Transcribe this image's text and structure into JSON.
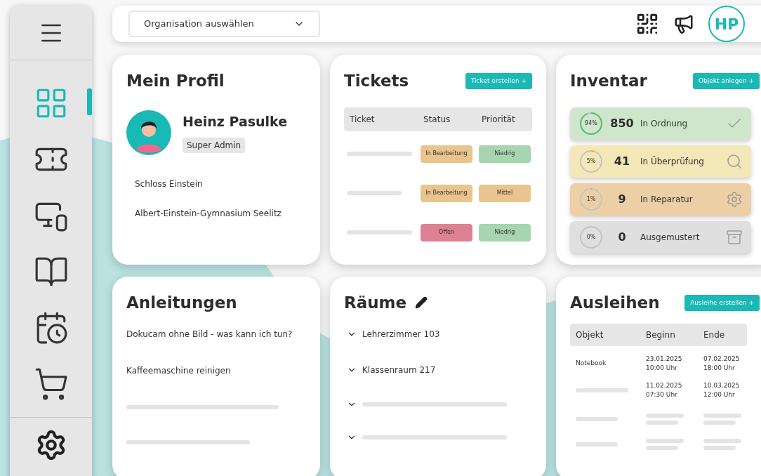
{
  "nav": {
    "items": [
      {
        "kind": "dashboard",
        "selected": true
      },
      {
        "kind": "tickets",
        "selected": false
      },
      {
        "kind": "devices",
        "selected": false
      },
      {
        "kind": "guides",
        "selected": false
      },
      {
        "kind": "calendar",
        "selected": false
      },
      {
        "kind": "shop",
        "selected": false
      }
    ]
  },
  "topbar": {
    "organisation_select": {
      "placeholder": "Organisation auswählen"
    },
    "avatar": "HP"
  },
  "profile": {
    "title": "Mein Profil",
    "name": "Heinz Pasulke",
    "role": "Super Admin",
    "organisations": [
      "Schloss Einstein",
      "Albert-Einstein-Gymnasium Seelitz"
    ]
  },
  "tickets": {
    "title": "Tickets",
    "button": "Ticket erstellen +",
    "columns": [
      "Ticket",
      "Status",
      "Priorität"
    ],
    "rows": [
      {
        "status": {
          "text": "In Bearbeitung",
          "color": "#eac48d"
        },
        "priority": {
          "text": "Niedrig",
          "color": "#a6d5b0"
        }
      },
      {
        "status": {
          "text": "In Bearbeitung",
          "color": "#eac48d"
        },
        "priority": {
          "text": "Mittel",
          "color": "#eac48d"
        }
      },
      {
        "status": {
          "text": "Offen",
          "color": "#de8193"
        },
        "priority": {
          "text": "Niedrig",
          "color": "#a6d5b0"
        }
      }
    ]
  },
  "inventory": {
    "title": "Inventar",
    "button": "Objekt anlegen +",
    "rows": [
      {
        "kind": "ok",
        "percent": "94%",
        "level": 0.94,
        "count": "850",
        "label": "In Ordnung",
        "color": "#d0e6cc"
      },
      {
        "kind": "review",
        "percent": "5%",
        "level": 0.05,
        "count": "41",
        "label": "In Überprüfung",
        "color": "#f2e8b8"
      },
      {
        "kind": "repair",
        "percent": "1%",
        "level": 0.01,
        "count": "9",
        "label": "In Reparatur",
        "color": "#edcfa6"
      },
      {
        "kind": "retired",
        "percent": "0%",
        "level": 0,
        "count": "0",
        "label": "Ausgemustert",
        "color": "#dfdfdf"
      }
    ]
  },
  "guides": {
    "title": "Anleitungen",
    "items": [
      "Dokucam ohne Bild - was kann ich tun?",
      "Kaffeemaschine reinigen"
    ]
  },
  "rooms": {
    "title": "Räume",
    "items": [
      "Lehrerzimmer 103",
      "Klassenraum 217"
    ]
  },
  "loans": {
    "title": "Ausleihen",
    "button": "Ausleihe erstellen +",
    "columns": [
      "Objekt",
      "Beginn",
      "Ende"
    ],
    "rows": [
      {
        "object": "Notebook",
        "begin": [
          "23.01.2025",
          "10:00 Uhr"
        ],
        "end": [
          "07.02.2025",
          "18:00 Uhr"
        ]
      },
      {
        "begin": [
          "11.02.2025",
          "07:30 Uhr"
        ],
        "end": [
          "10.03.2025",
          "12:00 Uhr"
        ]
      }
    ]
  }
}
